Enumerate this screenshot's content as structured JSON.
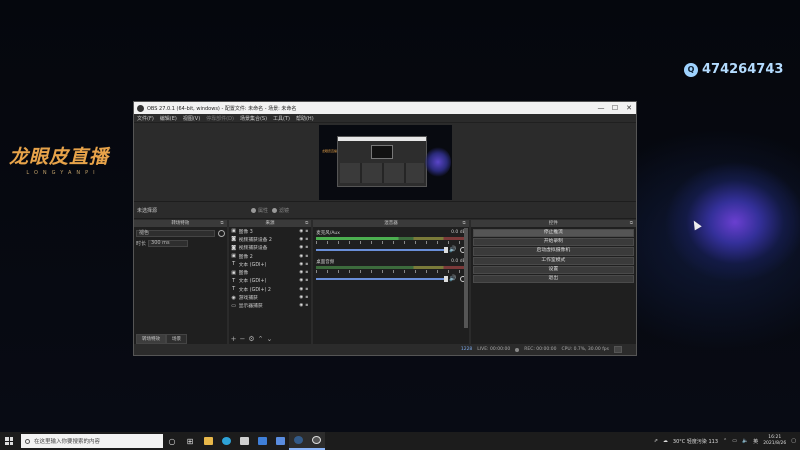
{
  "desktop": {
    "logo_cn": "龙眼皮直播",
    "logo_en": "LONGYANPI",
    "qq_number": "474264743",
    "qq_icon": "qq-icon"
  },
  "obs": {
    "title": "OBS 27.0.1 (64-bit, windows) - 配置文件: 未命名 - 场景: 未命名",
    "menu": [
      "文件(F)",
      "编辑(E)",
      "视图(V)",
      "停靠部件(D)",
      "场景集合(S)",
      "工具(T)",
      "帮助(H)"
    ],
    "scene_bar": {
      "name": "未选择源",
      "properties": "属性",
      "filters": "滤镜"
    },
    "filter_dock": {
      "title": "转场特效",
      "transition": "褪色",
      "duration_label": "时长",
      "duration_value": "300 ms",
      "tabs": [
        "转场特效",
        "场景"
      ]
    },
    "sources_dock": {
      "title": "来源",
      "items": [
        {
          "icon": "image-icon",
          "glyph": "▣",
          "name": "图像 3"
        },
        {
          "icon": "camera-icon",
          "glyph": "◙",
          "name": "视频捕获设备 2"
        },
        {
          "icon": "camera-icon",
          "glyph": "◙",
          "name": "视频捕获设备"
        },
        {
          "icon": "image-icon",
          "glyph": "▣",
          "name": "图像 2"
        },
        {
          "icon": "text-icon",
          "glyph": "T",
          "name": "文本 (GDI+)"
        },
        {
          "icon": "image-icon",
          "glyph": "▣",
          "name": "图像"
        },
        {
          "icon": "text-icon",
          "glyph": "T",
          "name": "文本 (GDI+)"
        },
        {
          "icon": "text-icon",
          "glyph": "T",
          "name": "文本 (GDI+) 2"
        },
        {
          "icon": "game-capture-icon",
          "glyph": "◉",
          "name": "游戏捕获"
        },
        {
          "icon": "display-capture-icon",
          "glyph": "▭",
          "name": "显示器捕获"
        }
      ]
    },
    "mixer_dock": {
      "title": "混音器",
      "channels": [
        {
          "name": "麦克风/Aux",
          "level": "0.0 dB",
          "active": true
        },
        {
          "name": "桌面音频",
          "level": "0.0 dB",
          "active": false
        }
      ]
    },
    "controls_dock": {
      "title": "控件",
      "buttons": [
        "停止推流",
        "开始录制",
        "启动虚拟摄像机",
        "工作室模式",
        "设置",
        "退出"
      ]
    },
    "status": {
      "lost_frames": "LIVE: 00:00:00",
      "rec": "REC: 00:00:00",
      "cpu": "CPU: 0.7%, 30.00 fps",
      "live_kb": "1228"
    }
  },
  "taskbar": {
    "search_placeholder": "在这里输入你要搜索的内容",
    "weather": "30°C 轻度污染 113",
    "time": "16:21",
    "date": "2021/8/26",
    "lang": "英"
  },
  "colors": {
    "accent_blue": "#6a8fd8",
    "logo_orange": "#e7a34a",
    "qq_blue": "#b4dcff"
  }
}
